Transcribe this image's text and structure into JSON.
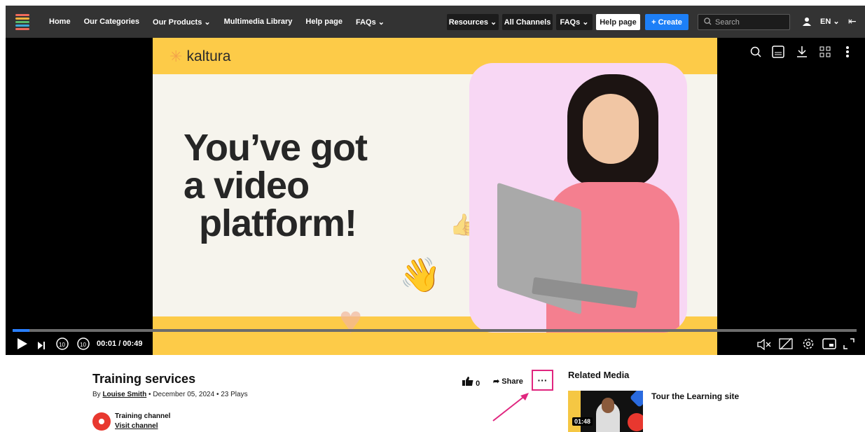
{
  "topbar": {
    "nav": [
      "Home",
      "Our Categories",
      "Our Products ⌄",
      "Multimedia Library",
      "Help page",
      "FAQs ⌄"
    ],
    "buttons": {
      "resources": "Resources ⌄",
      "all_channels": "All Channels",
      "faqs": "FAQs ⌄",
      "help": "Help page",
      "create": "+ Create"
    },
    "search_placeholder": "Search",
    "lang": "EN ⌄"
  },
  "player": {
    "slide_brand": "kaltura",
    "headline": [
      "You’ve got",
      "a video",
      "platform!"
    ],
    "time": "00:01 / 00:49",
    "progress_fraction": 0.02
  },
  "media": {
    "title": "Training services",
    "by_label": "By",
    "author": "Louise Smith",
    "date": "December 05, 2024",
    "plays": "23 Plays",
    "channel_name": "Training channel",
    "channel_link": "Visit channel",
    "likes": "0",
    "share": "Share",
    "more": "···"
  },
  "related": {
    "heading": "Related Media",
    "items": [
      {
        "title": "Tour the Learning site",
        "duration": "01:48"
      }
    ]
  }
}
